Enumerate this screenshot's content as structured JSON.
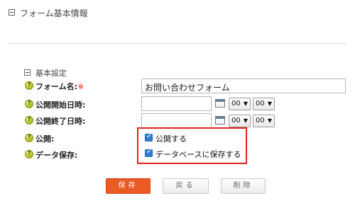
{
  "section": {
    "title": "フォーム基本情報"
  },
  "basic": {
    "title": "基本設定"
  },
  "fields": {
    "form_name": {
      "label": "フォーム名:",
      "required_mark": "※",
      "value": "お問い合わせフォーム"
    },
    "publish_start": {
      "label": "公開開始日時:",
      "date": "",
      "hour": "00",
      "minute": "00"
    },
    "publish_end": {
      "label": "公開終了日時:",
      "date": "",
      "hour": "00",
      "minute": "00"
    },
    "publish": {
      "label": "公開:",
      "checkbox_label": "公開する",
      "checked": true
    },
    "data_save": {
      "label": "データ保存:",
      "checkbox_label": "データベースに保存する",
      "checked": true
    }
  },
  "help_glyph": "?",
  "select_arrow": "▼",
  "check_glyph": "✓",
  "buttons": {
    "save": "保存",
    "back": "戻る",
    "delete": "削除"
  },
  "colors": {
    "save_button": "#ea5a23",
    "highlight_border": "#e0231d",
    "checkbox": "#2f7fd6",
    "help_icon": "#a8b81f"
  }
}
